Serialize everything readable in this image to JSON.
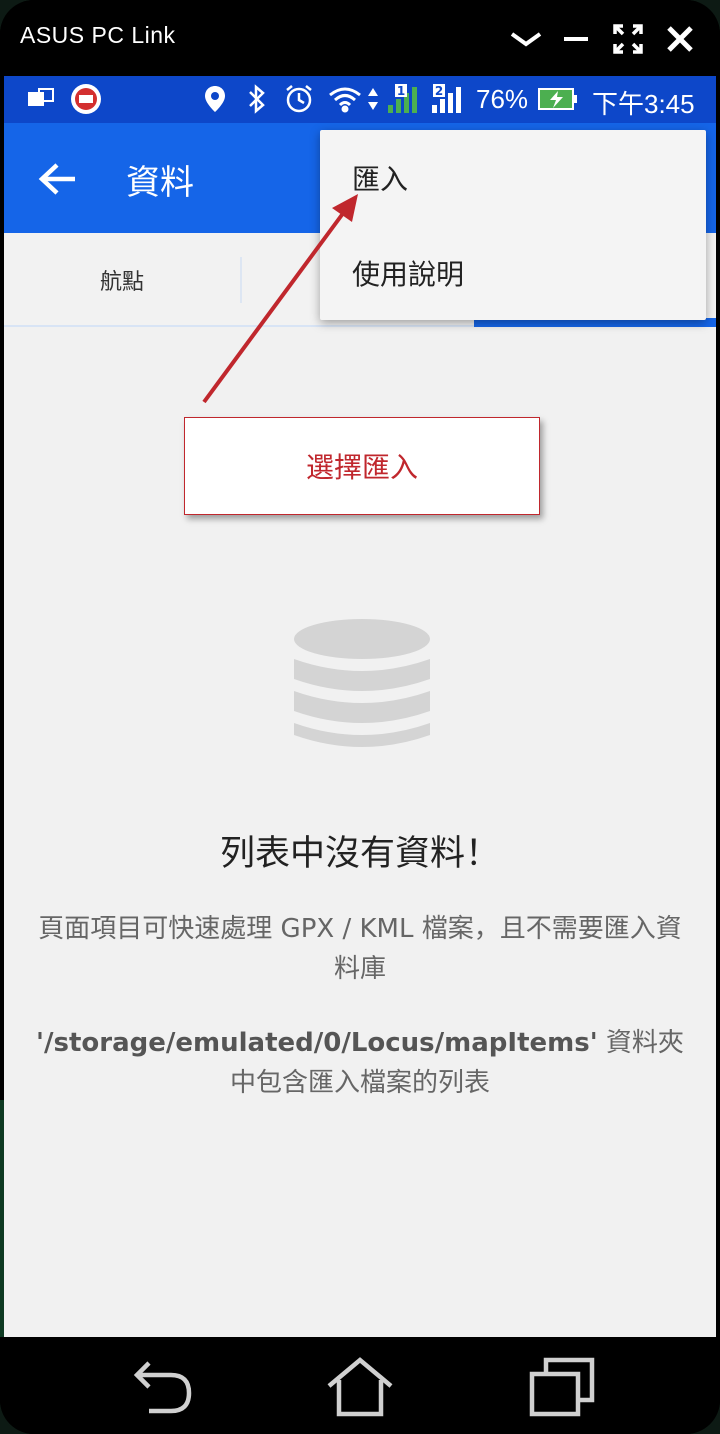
{
  "window": {
    "title": "ASUS PC Link",
    "controls": [
      "chevron-down-icon",
      "minimize-icon",
      "fullscreen-icon",
      "close-icon"
    ]
  },
  "status_bar": {
    "battery": "76%",
    "time": "下午3:45",
    "icons": [
      "screen-mirror-icon",
      "app-notification-icon",
      "location-icon",
      "bluetooth-icon",
      "alarm-icon",
      "wifi-icon",
      "signal-sim1-icon",
      "signal-sim2-icon",
      "battery-charging-icon"
    ],
    "sim1_label": "1",
    "sim2_label": "2"
  },
  "app_bar": {
    "title": "資料"
  },
  "tabs": [
    {
      "label": "航點"
    }
  ],
  "menu": {
    "items": [
      {
        "label": "匯入"
      },
      {
        "label": "使用說明"
      }
    ]
  },
  "annotation": {
    "text": "選擇匯入"
  },
  "empty_state": {
    "title": "列表中沒有資料！",
    "description": "頁面項目可快速處理 GPX / KML 檔案，且不需要匯入資料庫",
    "path": "'/storage/emulated/0/Locus/mapItems'",
    "path_suffix": " 資料夾中包含匯入檔案的列表"
  },
  "colors": {
    "status_bar": "#0d47c9",
    "app_bar": "#1565e8",
    "annotation": "#c0272d",
    "battery": "#4caf50",
    "signal": "#4caf50"
  }
}
